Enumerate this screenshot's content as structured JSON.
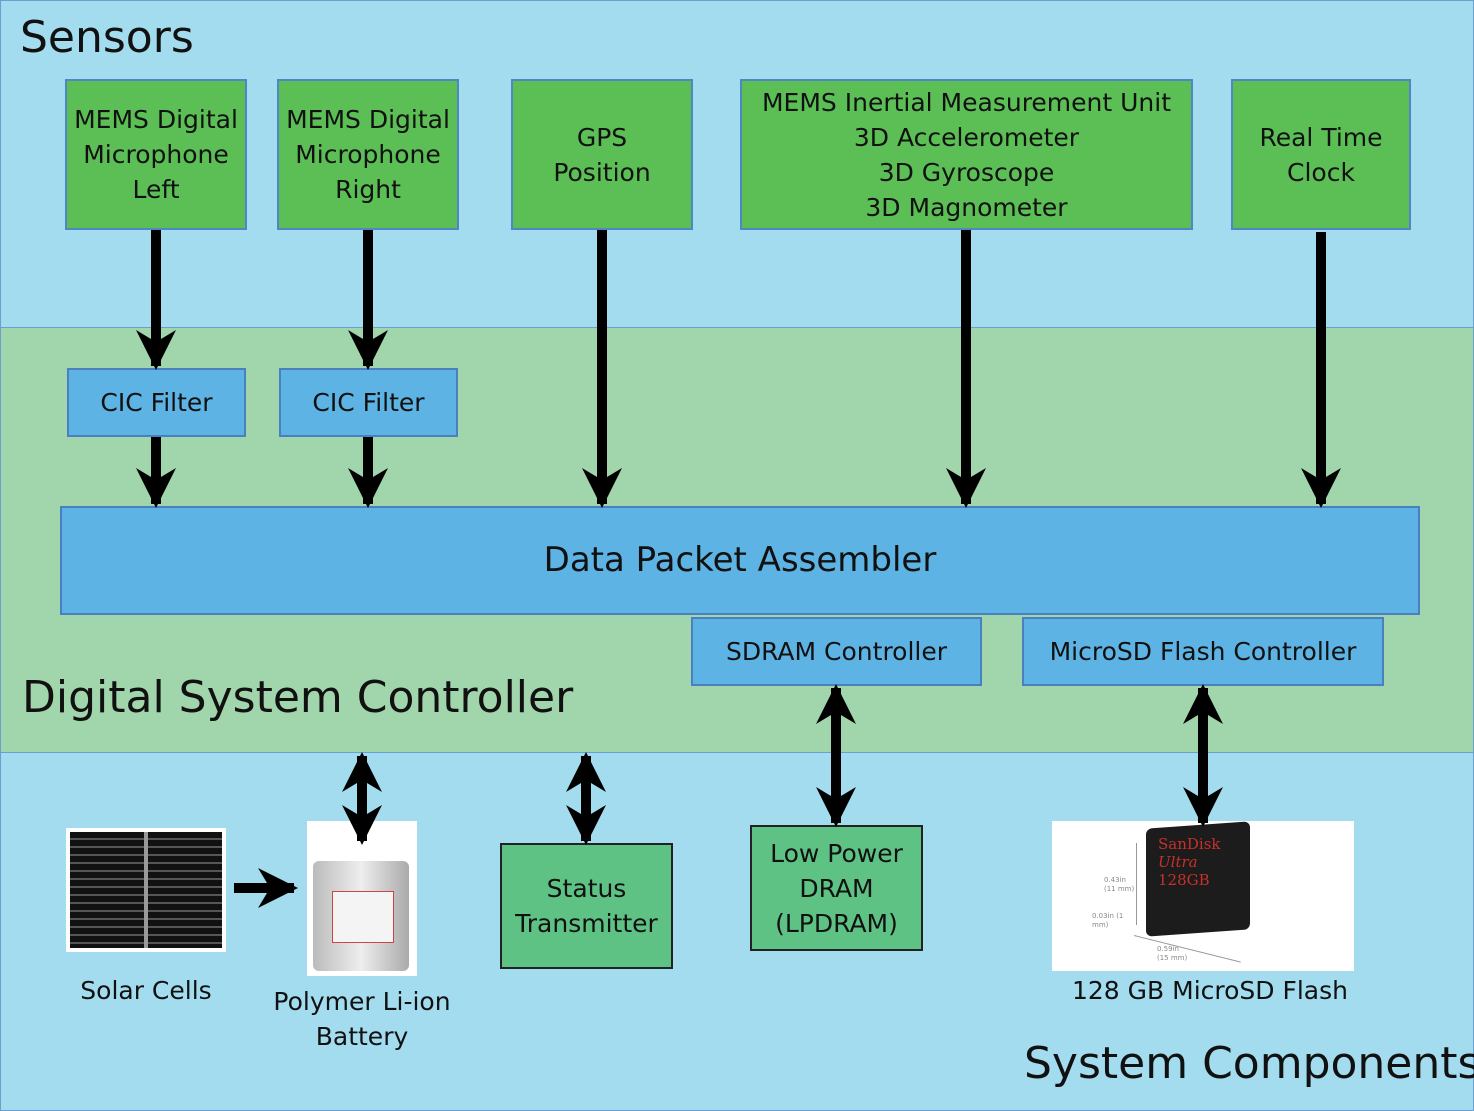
{
  "sections": {
    "sensors": "Sensors",
    "controller": "Digital System Controller",
    "components": "System Components"
  },
  "sensors": [
    {
      "label": "MEMS Digital\nMicrophone\nLeft"
    },
    {
      "label": "MEMS Digital\nMicrophone\nRight"
    },
    {
      "label": "GPS\nPosition"
    },
    {
      "label": "MEMS Inertial Measurement Unit\n3D Accelerometer\n3D Gyroscope\n3D Magnometer"
    },
    {
      "label": "Real Time\nClock"
    }
  ],
  "controller": {
    "cic_left": "CIC Filter",
    "cic_right": "CIC Filter",
    "assembler": "Data Packet Assembler",
    "sdram": "SDRAM Controller",
    "microsd": "MicroSD Flash Controller"
  },
  "components": {
    "solar": "Solar Cells",
    "battery": "Polymer Li-ion\nBattery",
    "status": "Status\nTransmitter",
    "dram": "Low Power\nDRAM\n(LPDRAM)",
    "flash": "128 GB MicroSD Flash"
  },
  "sd_card_image": {
    "brand": "SanDisk",
    "line": "Ultra",
    "capacity": "128GB",
    "dims": [
      "0.43in (11 mm)",
      "0.03in (1 mm)",
      "0.59in (15 mm)"
    ]
  },
  "colors": {
    "sensor_band": "#a3dcef",
    "controller_band": "#a1d5ab",
    "sensor_box": "#5bbf55",
    "controller_box": "#5db3e3",
    "component_box": "#5ec285"
  }
}
